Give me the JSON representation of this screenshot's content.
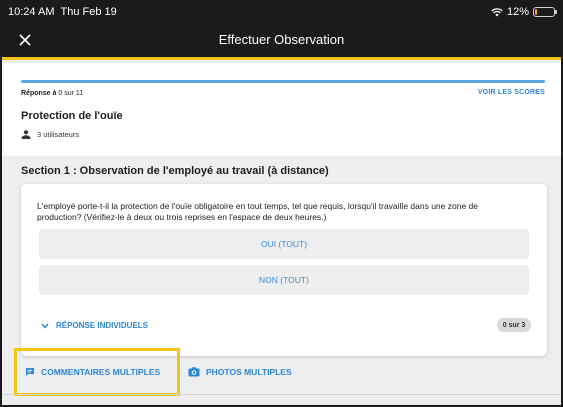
{
  "status_bar": {
    "time": "10:24 AM",
    "date": "Thu Feb 19",
    "battery": "12%",
    "battery_level": 0.12
  },
  "header": {
    "title": "Effectuer Observation"
  },
  "info": {
    "reponse_prefix": "Réponse à",
    "reponse_value": "0 sur 11",
    "progress_fraction": 1.0,
    "voir_scores": "VOIR LES SCORES",
    "title": "Protection de l'ouïe",
    "users": "3 utilisateurs"
  },
  "section": {
    "title": "Section 1 : Observation de l'employé au travail (à distance)"
  },
  "question": {
    "text": "L'employé porte-t-il la protection de l'ouïe obligatoire en tout temps, tel que requis, lorsqu'il travaille dans une zone de production?   (Vérifiez-le à deux ou trois reprises en l'espace de deux heures.)",
    "option_yes": "OUI (TOUT)",
    "option_no": "NON (TOUT)",
    "individual_label": "RÉPONSE INDIVIDUELS",
    "individual_count": "0 sur 3"
  },
  "actions": {
    "comments": "COMMENTAIRES MULTIPLES",
    "photos": "PHOTOS MULTIPLES"
  },
  "colors": {
    "accent": "#2f86d6",
    "highlight": "#f5c518",
    "header_bg": "#1b1b1b"
  }
}
